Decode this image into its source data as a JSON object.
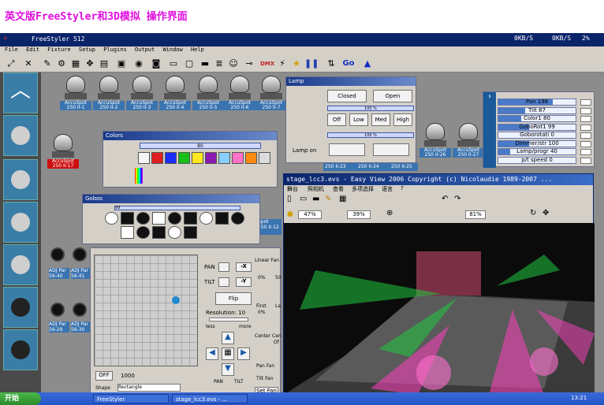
{
  "heading": "英文版FreeStyler和3D模拟 操作界面",
  "app": {
    "title": "FreeStyler 512",
    "net": [
      "0KB/S",
      "0KB/S",
      "2%"
    ],
    "menu": [
      "File",
      "Edit",
      "Fixture",
      "Setup",
      "Plugins",
      "Output",
      "Window",
      "Help"
    ]
  },
  "fixtures": [
    {
      "label": "AccuSpot 250 II-1",
      "num": "100"
    },
    {
      "label": "AccuSpot 250 II-2",
      "num": "100"
    },
    {
      "label": "AccuSpot 250 II-3",
      "num": "100"
    },
    {
      "label": "AccuSpot 250 II-4",
      "num": "100"
    },
    {
      "label": "AccuSpot 250 II-5",
      "num": "100"
    },
    {
      "label": "AccuSpot 250 II-6",
      "num": "100"
    },
    {
      "label": "AccuSpot 250 II-7",
      "num": "100"
    },
    {
      "label": "AccuSpot 250 II-17",
      "num": "100"
    },
    {
      "label": "AccuSpot 250 II-26",
      "num": "100"
    },
    {
      "label": "AccuSpot 250 II-27",
      "num": "100"
    }
  ],
  "small_labels": [
    "250 II-23",
    "250 II-24",
    "250 II-25",
    "Spot",
    "250 II-12"
  ],
  "pars": [
    "ADJ Par 56-40",
    "ADJ Par 56-41",
    "ADJ Par 56-29",
    "ADJ Par 56-30"
  ],
  "lamp": {
    "title": "Lamp",
    "closed": "Closed",
    "open": "Open",
    "pct1": "100 %",
    "off": "Off",
    "low": "Low",
    "med": "Med",
    "high": "High",
    "pct2": "100 %",
    "lamp_on": "Lamp on"
  },
  "colors": {
    "title": "Colors",
    "value": "80",
    "swatches": [
      "#f4f4f4",
      "#e02020",
      "#1c2cff",
      "#18c018",
      "#ffe820",
      "#8a1ab0",
      "#8ad0ff",
      "#ff70c8",
      "#ff8a10",
      "#dcdcdc"
    ]
  },
  "gobos": {
    "title": "Gobos",
    "value": "99"
  },
  "pantilt": {
    "pan": "PAN",
    "tilt": "TILT",
    "x": "-X",
    "y": "-Y",
    "flip": "Flip",
    "resolution": "Resolution: 10",
    "less": "less",
    "more": "more",
    "off": "OFF",
    "val": "1000",
    "shape": "Shape",
    "rect": "Rectangle",
    "pan2": "PAN",
    "tilt2": "TILT",
    "linear": "Linear Fan",
    "p0": "0%",
    "p50": "50",
    "first": "First",
    "last": "La",
    "center": "Center",
    "cen": "Cen",
    "off2": "Of",
    "panfan": "Pan Fan",
    "tiltfan": "Tilt Fan",
    "setfan": "Set Fan"
  },
  "params": [
    {
      "name": "Pan",
      "val": "198",
      "level": 0.7
    },
    {
      "name": "Tilt",
      "val": "87",
      "level": 0.35
    },
    {
      "name": "Color1",
      "val": "80",
      "level": 0.3
    },
    {
      "name": "GoboRot1",
      "val": "99",
      "level": 0.4
    },
    {
      "name": "Goborotati",
      "val": "0",
      "level": 0.0
    },
    {
      "name": "Dimmer/str",
      "val": "100",
      "level": 0.4
    },
    {
      "name": "Lamp/progr",
      "val": "40",
      "level": 0.15
    },
    {
      "name": "p/t speed",
      "val": "0",
      "level": 0.0
    }
  ],
  "easy": {
    "title": "stage_lcc3.evs - Easy View 2006   Copyright (c) Nicolaudie 1989-2007 ...",
    "menu": [
      "舞台",
      "照相机",
      "查看",
      "多项选择",
      "语言",
      "?"
    ],
    "z1": "47%",
    "z2": "39%",
    "z3": "81%"
  },
  "taskbar": {
    "start": "开始",
    "tasks": [
      "FreeStyler",
      "stage_lcc3.evs - ..."
    ],
    "time": "13:21"
  },
  "colors_accent": {
    "titlebar": "#0a246a",
    "fixture_label": "#3a74b0",
    "selected_label": "#cc1111",
    "heading": "#e010e0"
  }
}
